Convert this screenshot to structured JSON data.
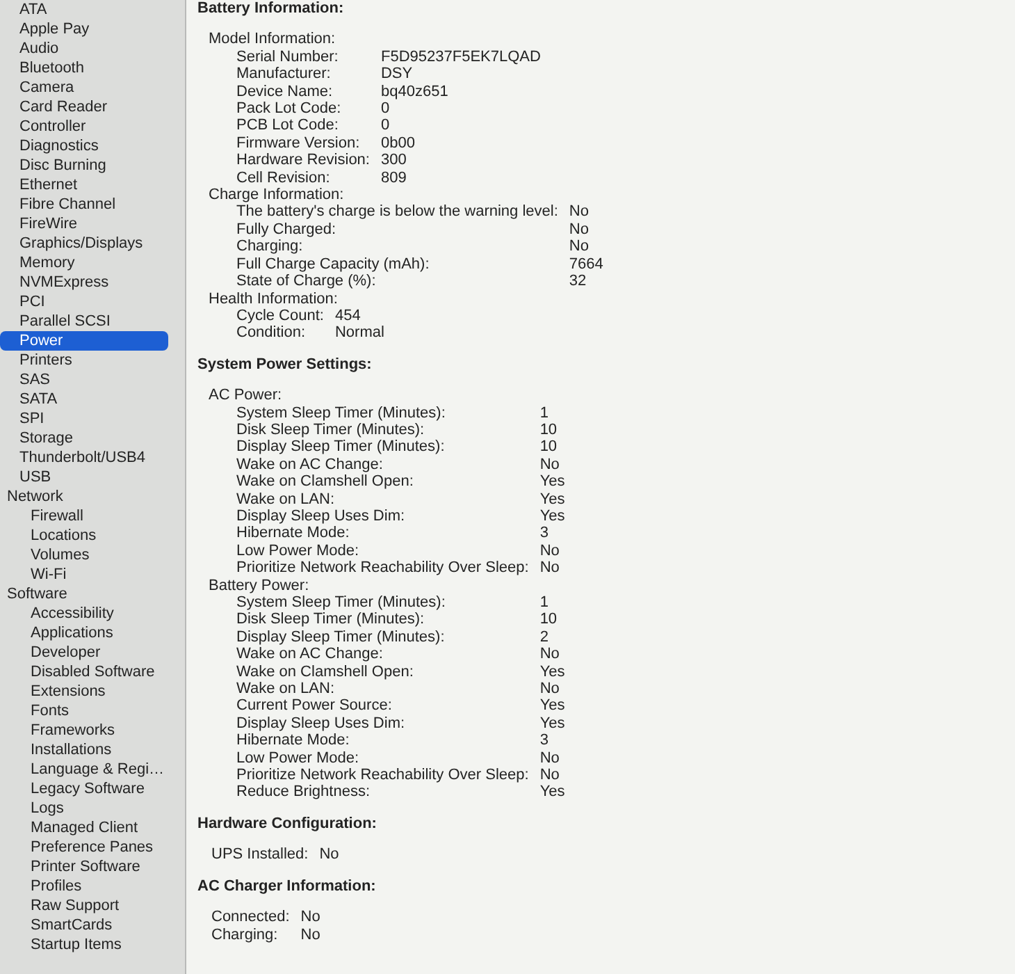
{
  "sidebar": {
    "items": [
      {
        "label": "ATA",
        "selected": false
      },
      {
        "label": "Apple Pay",
        "selected": false
      },
      {
        "label": "Audio",
        "selected": false
      },
      {
        "label": "Bluetooth",
        "selected": false
      },
      {
        "label": "Camera",
        "selected": false
      },
      {
        "label": "Card Reader",
        "selected": false
      },
      {
        "label": "Controller",
        "selected": false
      },
      {
        "label": "Diagnostics",
        "selected": false
      },
      {
        "label": "Disc Burning",
        "selected": false
      },
      {
        "label": "Ethernet",
        "selected": false
      },
      {
        "label": "Fibre Channel",
        "selected": false
      },
      {
        "label": "FireWire",
        "selected": false
      },
      {
        "label": "Graphics/Displays",
        "selected": false
      },
      {
        "label": "Memory",
        "selected": false
      },
      {
        "label": "NVMExpress",
        "selected": false
      },
      {
        "label": "PCI",
        "selected": false
      },
      {
        "label": "Parallel SCSI",
        "selected": false
      },
      {
        "label": "Power",
        "selected": true
      },
      {
        "label": "Printers",
        "selected": false
      },
      {
        "label": "SAS",
        "selected": false
      },
      {
        "label": "SATA",
        "selected": false
      },
      {
        "label": "SPI",
        "selected": false
      },
      {
        "label": "Storage",
        "selected": false
      },
      {
        "label": "Thunderbolt/USB4",
        "selected": false
      },
      {
        "label": "USB",
        "selected": false
      }
    ],
    "sections": [
      {
        "label": "Network",
        "selected": false,
        "children": [
          {
            "label": "Firewall",
            "selected": false
          },
          {
            "label": "Locations",
            "selected": false
          },
          {
            "label": "Volumes",
            "selected": false
          },
          {
            "label": "Wi-Fi",
            "selected": false
          }
        ]
      },
      {
        "label": "Software",
        "selected": false,
        "children": [
          {
            "label": "Accessibility",
            "selected": false
          },
          {
            "label": "Applications",
            "selected": false
          },
          {
            "label": "Developer",
            "selected": false
          },
          {
            "label": "Disabled Software",
            "selected": false
          },
          {
            "label": "Extensions",
            "selected": false
          },
          {
            "label": "Fonts",
            "selected": false
          },
          {
            "label": "Frameworks",
            "selected": false
          },
          {
            "label": "Installations",
            "selected": false
          },
          {
            "label": "Language & Regi…",
            "selected": false
          },
          {
            "label": "Legacy Software",
            "selected": false
          },
          {
            "label": "Logs",
            "selected": false
          },
          {
            "label": "Managed Client",
            "selected": false
          },
          {
            "label": "Preference Panes",
            "selected": false
          },
          {
            "label": "Printer Software",
            "selected": false
          },
          {
            "label": "Profiles",
            "selected": false
          },
          {
            "label": "Raw Support",
            "selected": false
          },
          {
            "label": "SmartCards",
            "selected": false
          },
          {
            "label": "Startup Items",
            "selected": false
          }
        ]
      }
    ]
  },
  "report": {
    "sections": [
      {
        "title": "Battery Information:",
        "groups": [
          {
            "title": "Model Information:",
            "rows": [
              {
                "label": "Serial Number:",
                "value": "F5D95237F5EK7LQAD"
              },
              {
                "label": "Manufacturer:",
                "value": "DSY"
              },
              {
                "label": "Device Name:",
                "value": "bq40z651"
              },
              {
                "label": "Pack Lot Code:",
                "value": "0"
              },
              {
                "label": "PCB Lot Code:",
                "value": "0"
              },
              {
                "label": "Firmware Version:",
                "value": "0b00"
              },
              {
                "label": "Hardware Revision:",
                "value": "300"
              },
              {
                "label": "Cell Revision:",
                "value": "809"
              }
            ]
          },
          {
            "title": "Charge Information:",
            "rows": [
              {
                "label": "The battery's charge is below the warning level:",
                "value": "No"
              },
              {
                "label": "Fully Charged:",
                "value": "No"
              },
              {
                "label": "Charging:",
                "value": "No"
              },
              {
                "label": "Full Charge Capacity (mAh):",
                "value": "7664"
              },
              {
                "label": "State of Charge (%):",
                "value": "32"
              }
            ]
          },
          {
            "title": "Health Information:",
            "rows": [
              {
                "label": "Cycle Count:",
                "value": "454"
              },
              {
                "label": "Condition:",
                "value": "Normal"
              }
            ]
          }
        ]
      },
      {
        "title": "System Power Settings:",
        "groups": [
          {
            "title": "AC Power:",
            "rows": [
              {
                "label": "System Sleep Timer (Minutes):",
                "value": "1"
              },
              {
                "label": "Disk Sleep Timer (Minutes):",
                "value": "10"
              },
              {
                "label": "Display Sleep Timer (Minutes):",
                "value": "10"
              },
              {
                "label": "Wake on AC Change:",
                "value": "No"
              },
              {
                "label": "Wake on Clamshell Open:",
                "value": "Yes"
              },
              {
                "label": "Wake on LAN:",
                "value": "Yes"
              },
              {
                "label": "Display Sleep Uses Dim:",
                "value": "Yes"
              },
              {
                "label": "Hibernate Mode:",
                "value": "3"
              },
              {
                "label": "Low Power Mode:",
                "value": "No"
              },
              {
                "label": "Prioritize Network Reachability Over Sleep:",
                "value": "No"
              }
            ]
          },
          {
            "title": "Battery Power:",
            "rows": [
              {
                "label": "System Sleep Timer (Minutes):",
                "value": "1"
              },
              {
                "label": "Disk Sleep Timer (Minutes):",
                "value": "10"
              },
              {
                "label": "Display Sleep Timer (Minutes):",
                "value": "2"
              },
              {
                "label": "Wake on AC Change:",
                "value": "No"
              },
              {
                "label": "Wake on Clamshell Open:",
                "value": "Yes"
              },
              {
                "label": "Wake on LAN:",
                "value": "No"
              },
              {
                "label": "Current Power Source:",
                "value": "Yes"
              },
              {
                "label": "Display Sleep Uses Dim:",
                "value": "Yes"
              },
              {
                "label": "Hibernate Mode:",
                "value": "3"
              },
              {
                "label": "Low Power Mode:",
                "value": "No"
              },
              {
                "label": "Prioritize Network Reachability Over Sleep:",
                "value": "No"
              },
              {
                "label": "Reduce Brightness:",
                "value": "Yes"
              }
            ]
          }
        ]
      },
      {
        "title": "Hardware Configuration:",
        "rows": [
          {
            "label": "UPS Installed:",
            "value": "No"
          }
        ]
      },
      {
        "title": "AC Charger Information:",
        "rows": [
          {
            "label": "Connected:",
            "value": "No"
          },
          {
            "label": "Charging:",
            "value": "No"
          }
        ]
      }
    ]
  }
}
